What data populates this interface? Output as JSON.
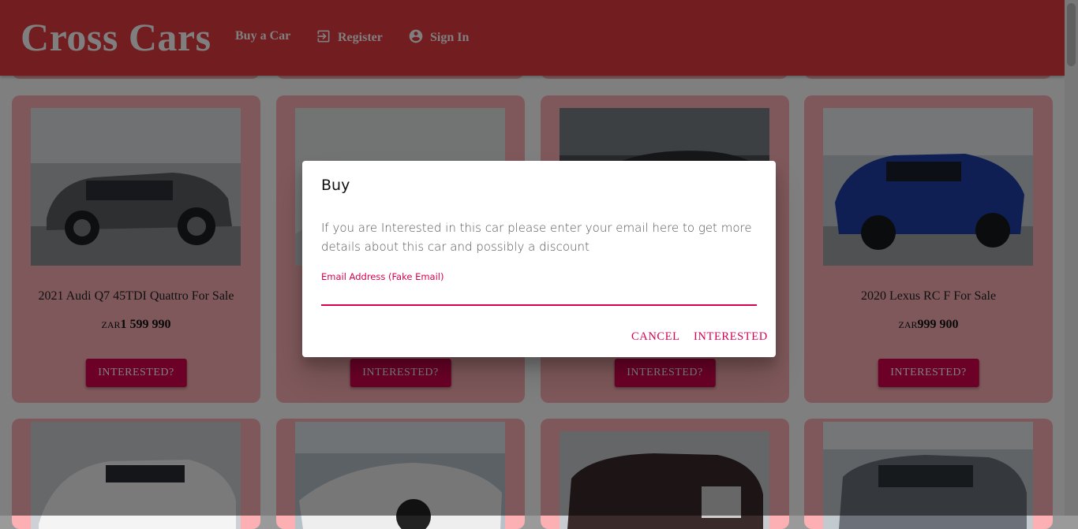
{
  "brand": "Cross Cars",
  "nav": [
    {
      "label": "Buy a Car",
      "icon": "car-icon"
    },
    {
      "label": "Register",
      "icon": "login-icon"
    },
    {
      "label": "Sign In",
      "icon": "account-circle-icon"
    }
  ],
  "cards": [
    {
      "title": "2021 Audi Q7 45TDI Quattro For Sale",
      "currency": "ZAR",
      "price": "1 599 990",
      "button": "INTERESTED?"
    },
    {
      "title": "",
      "currency": "",
      "price": "",
      "button": "INTERESTED?"
    },
    {
      "title": "",
      "currency": "",
      "price": "",
      "button": "INTERESTED?"
    },
    {
      "title": "2020 Lexus RC F For Sale",
      "currency": "ZAR",
      "price": "999 900",
      "button": "INTERESTED?"
    }
  ],
  "dialog": {
    "title": "Buy",
    "text": "If you are Interested in this car please enter your email here to get more details about this car and possibly a discount",
    "input_label": "Email Address (Fake Email)",
    "input_value": "",
    "cancel": "CANCEL",
    "confirm": "INTERESTED"
  },
  "colors": {
    "appbar": "#e53a3f",
    "card": "#fdb0b4",
    "accent": "#d8004f"
  }
}
